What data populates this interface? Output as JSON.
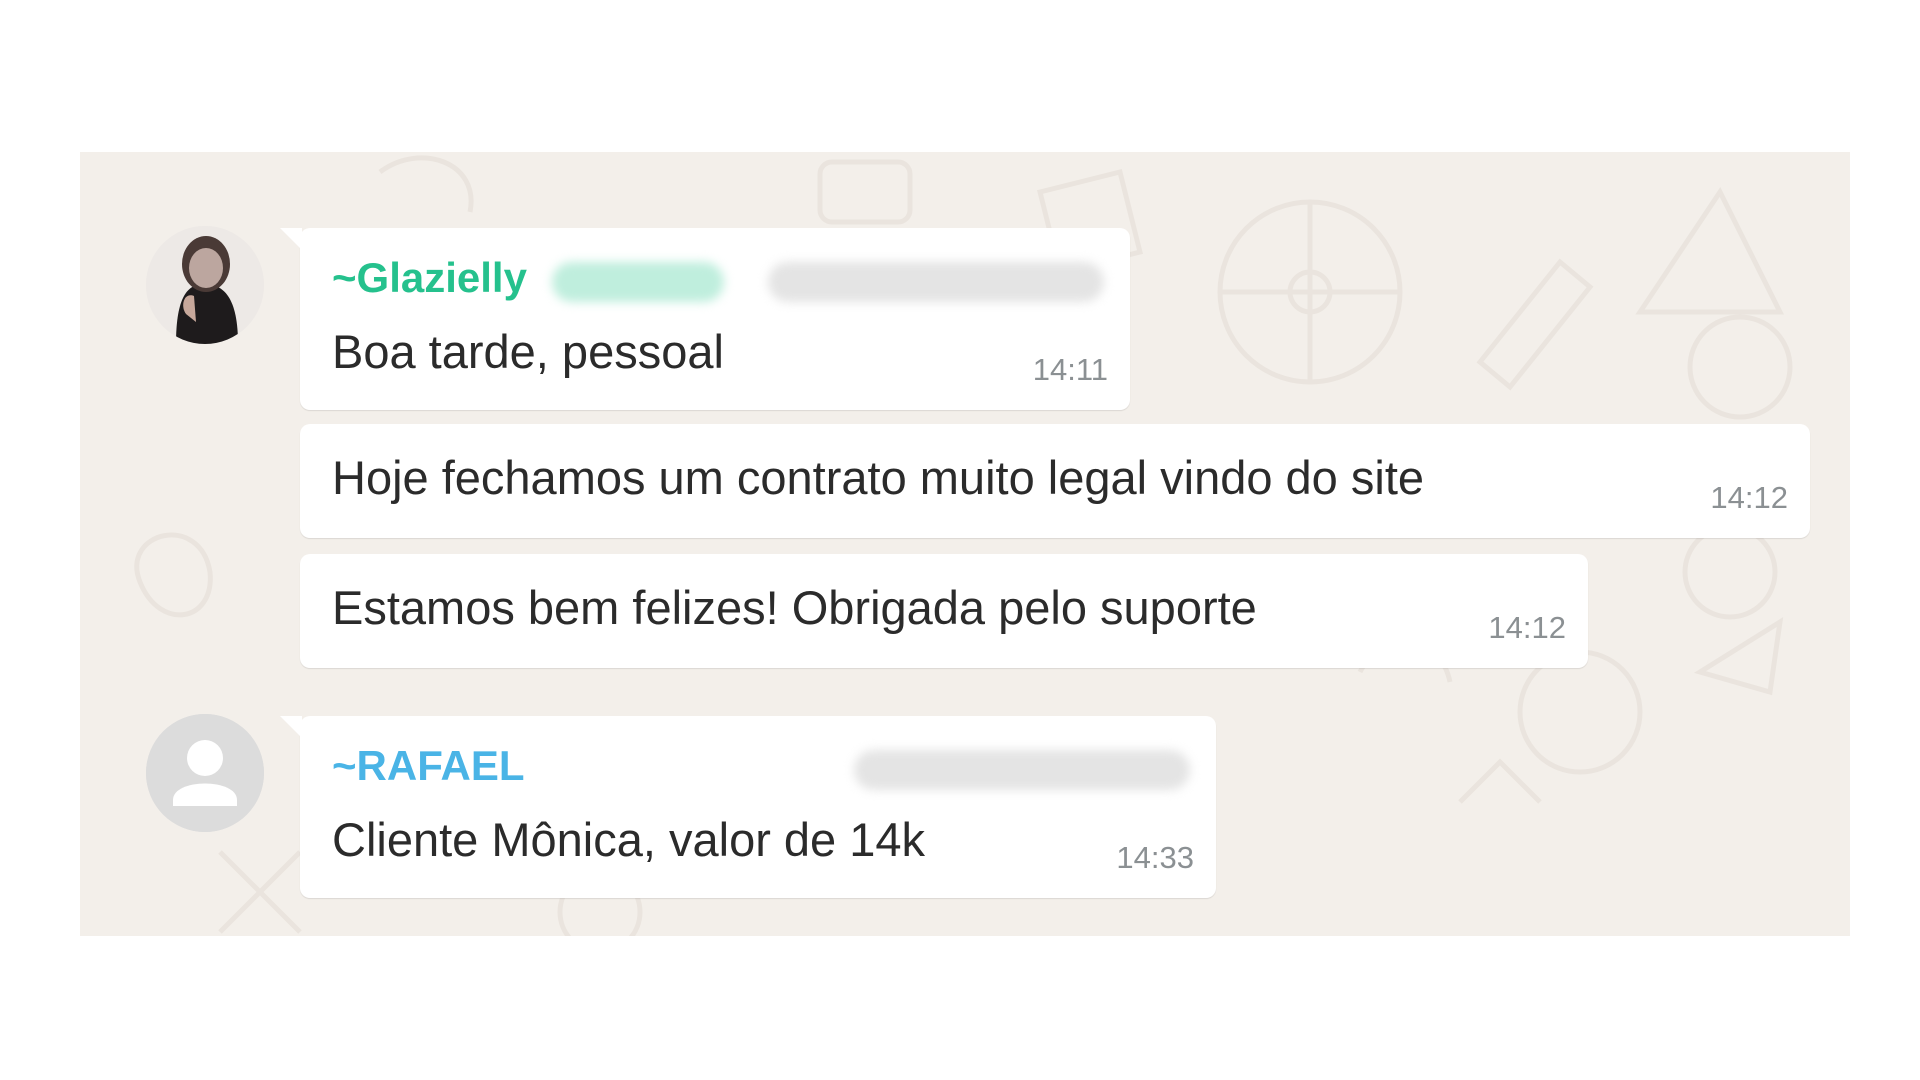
{
  "colors": {
    "chat_background": "#f3efea",
    "bubble_background": "#ffffff",
    "sender_glazielly": "#25c18d",
    "sender_rafael": "#4ab4e6",
    "message_text": "#2b2b2b",
    "timestamp_text": "#8b9093"
  },
  "messages": [
    {
      "sender": "~Glazielly",
      "text": "Boa tarde, pessoal",
      "time": "14:11",
      "avatar_icon": "user-photo-avatar"
    },
    {
      "text": "Hoje fechamos um contrato muito legal vindo do site",
      "time": "14:12"
    },
    {
      "text": "Estamos bem felizes! Obrigada pelo suporte",
      "time": "14:12"
    },
    {
      "sender": "~RAFAEL",
      "text": "Cliente Mônica, valor de 14k",
      "time": "14:33",
      "avatar_icon": "default-user-avatar-icon"
    }
  ]
}
